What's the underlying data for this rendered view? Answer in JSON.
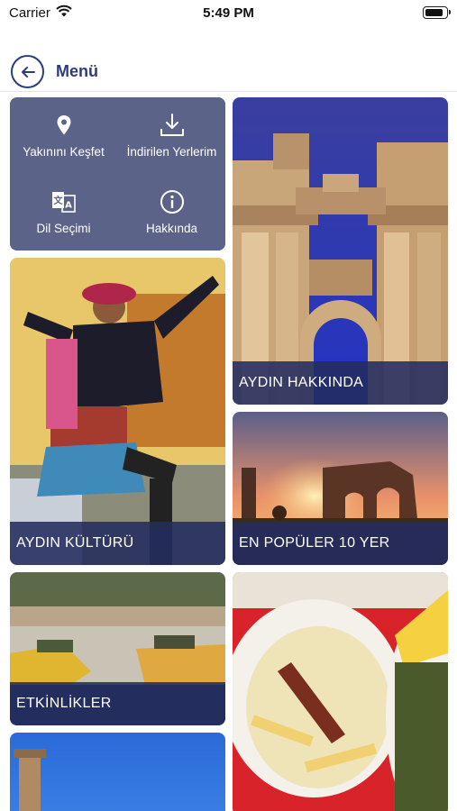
{
  "status": {
    "carrier": "Carrier",
    "time": "5:49 PM",
    "battery_level": 0.9
  },
  "nav": {
    "title": "Menü"
  },
  "menu": {
    "items": [
      {
        "label": "Yakınını Keşfet",
        "icon": "location-pin-icon"
      },
      {
        "label": "İndirilen Yerlerim",
        "icon": "download-icon"
      },
      {
        "label": "Dil Seçimi",
        "icon": "language-icon"
      },
      {
        "label": "Hakkında",
        "icon": "info-icon"
      }
    ]
  },
  "cards": {
    "aydin_hakkinda": "AYDIN HAKKINDA",
    "aydin_kulturu": "AYDIN KÜLTÜRÜ",
    "en_populer": "EN POPÜLER 10 YER",
    "etkinlikler": "ETKİNLİKLER"
  },
  "colors": {
    "accent": "#2c3d7a",
    "menu_tile": "#5b6389",
    "label_band": "#232c5f"
  }
}
